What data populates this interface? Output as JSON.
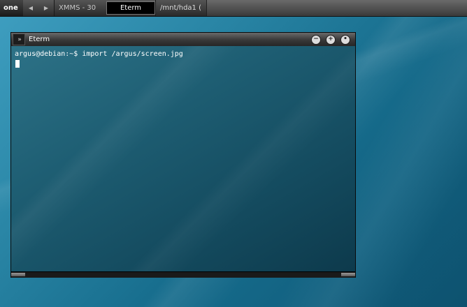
{
  "taskbar": {
    "workspace": "one",
    "prev_icon": "left-arrow-icon",
    "next_icon": "right-arrow-icon",
    "tasks": [
      {
        "label": "XMMS - 30"
      },
      {
        "label": "Eterm"
      },
      {
        "label": "/mnt/hda1 ("
      }
    ]
  },
  "window": {
    "title": "Eterm",
    "menu_icon": "double-chevron-icon",
    "buttons": {
      "minimize": "−",
      "maximize": "+",
      "close": "•"
    },
    "terminal": {
      "prompt_line": "argus@debian:~$ import /argus/screen.jpg"
    }
  }
}
